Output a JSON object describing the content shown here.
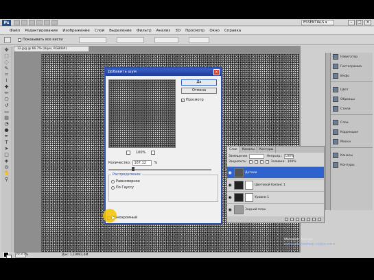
{
  "app": {
    "logo": "Ps",
    "workspace": "ESSENTIALS ▾"
  },
  "menu": [
    "Файл",
    "Редактирование",
    "Изображение",
    "Слой",
    "Выделение",
    "Фильтр",
    "Анализ",
    "3D",
    "Просмотр",
    "Окно",
    "Справка"
  ],
  "options": {
    "checkbox_label": "Показывать все кисти"
  },
  "document": {
    "tab_title": "32.jpg @ 66.7% (Шум, RGB/8#)"
  },
  "status": {
    "zoom": "66.67%",
    "doc_info": "Док: 1,19М/3,4М"
  },
  "watermark": {
    "line1": "Михаил Антон",
    "line2": "www.photoshop-video.com"
  },
  "dialog": {
    "title": "Добавить шум",
    "ok_label": "Да",
    "cancel_label": "Отмена",
    "preview_label": "Просмотр",
    "zoom_pct": "100%",
    "amount_label": "Количество:",
    "amount_value": "167,12",
    "amount_unit": "%",
    "distribution_label": "Распределение",
    "uniform_label": "Равномерное",
    "gaussian_label": "По Гауссу",
    "monochrome_label": "Монохромный"
  },
  "layers": {
    "tabs": [
      "Слои",
      "Каналы",
      "Контуры"
    ],
    "blend_mode": "Замещение",
    "opacity_label": "Непрозр.:",
    "opacity": "100%",
    "lock_label": "Закрепить:",
    "fill_label": "Заливка:",
    "fill": "100%",
    "rows": [
      {
        "name": "Детали"
      },
      {
        "name": "Цветовой баланс 1"
      },
      {
        "name": "Уровни 1"
      },
      {
        "name": "Задний план"
      }
    ]
  },
  "dock": {
    "group1": [
      "Навигатор",
      "Гистограмма",
      "Инфо"
    ],
    "group2": [
      "Цвет",
      "Образцы",
      "Стили"
    ],
    "group3": [
      "Слои",
      "Коррекция",
      "Маски"
    ],
    "group4": [
      "Каналы",
      "Контуры"
    ]
  }
}
